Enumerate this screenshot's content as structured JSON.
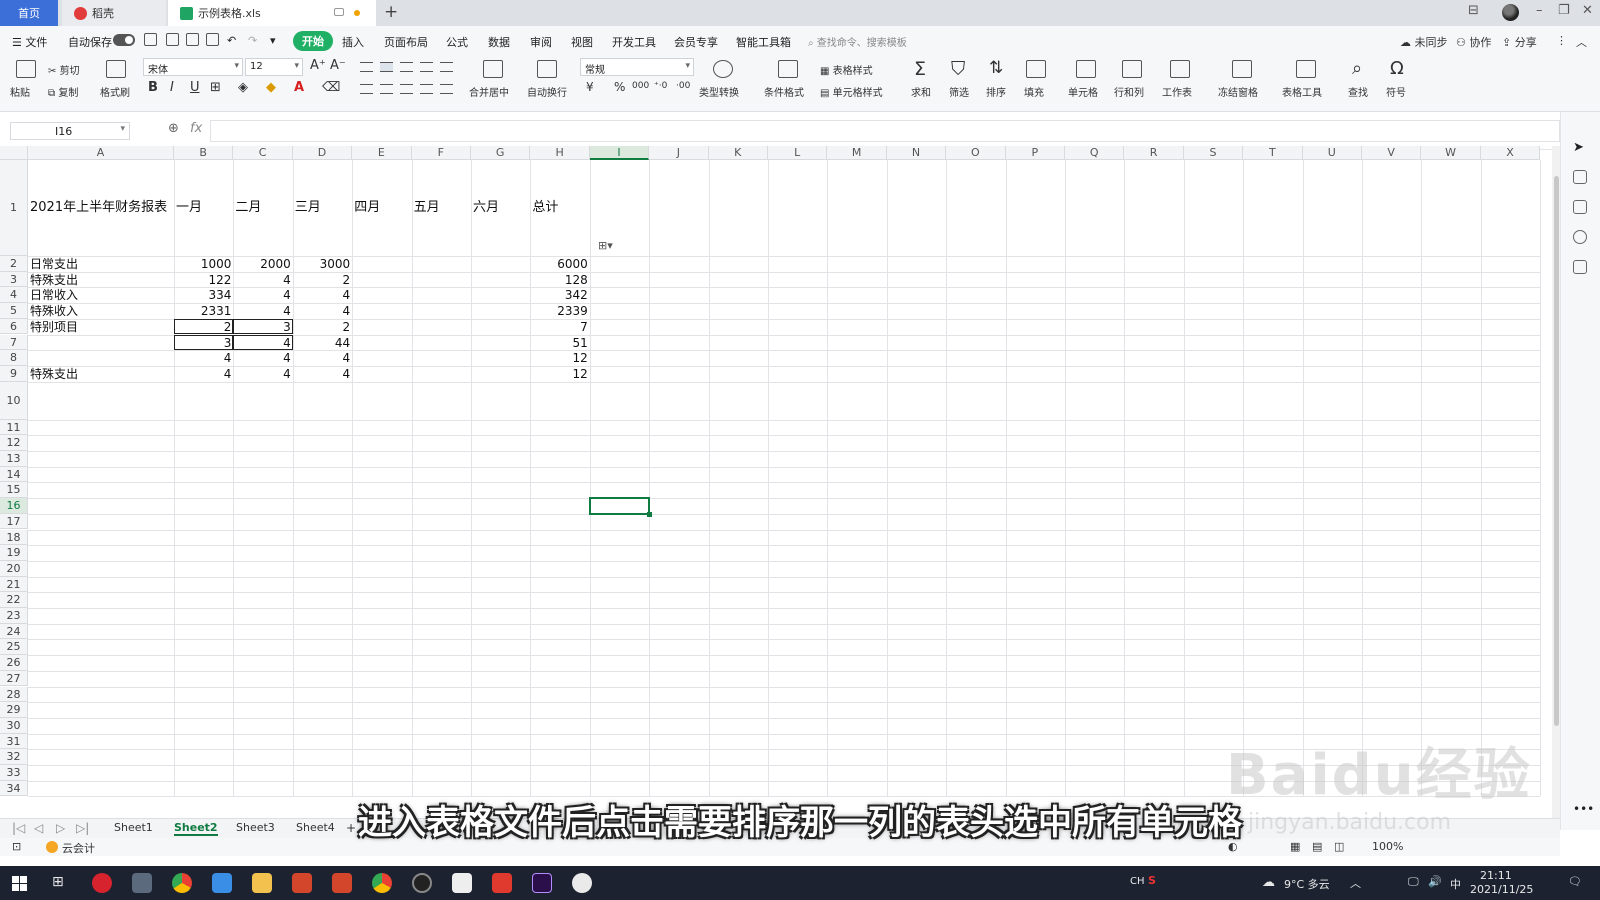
{
  "tabs": [
    {
      "label": "首页",
      "active": true
    },
    {
      "label": "稻壳",
      "active": false
    },
    {
      "label": "示例表格.xls",
      "active": true
    }
  ],
  "menu": {
    "file": "文件",
    "autosave": "自动保存",
    "items": [
      "开始",
      "插入",
      "页面布局",
      "公式",
      "数据",
      "审阅",
      "视图",
      "开发工具",
      "会员专享",
      "智能工具箱"
    ],
    "active_item": "开始",
    "search_placeholder": "查找命令、搜索模板",
    "sync": "未同步",
    "collab": "协作",
    "share": "分享"
  },
  "ribbon": {
    "paste": "粘贴",
    "cut": "剪切",
    "copy": "复制",
    "format_painter": "格式刷",
    "font_name": "宋体",
    "font_size": "12",
    "bold": "B",
    "italic": "I",
    "underline": "U",
    "merge_center": "合并居中",
    "wrap_text": "自动换行",
    "number_format": "常规",
    "type_convert": "类型转换",
    "conditional_format": "条件格式",
    "table_style": "表格样式",
    "cell_style": "单元格样式",
    "sum": "求和",
    "filter": "筛选",
    "sort": "排序",
    "fill": "填充",
    "cell": "单元格",
    "row_col": "行和列",
    "worksheet": "工作表",
    "freeze": "冻结窗格",
    "table_tools": "表格工具",
    "find": "查找",
    "symbol": "符号",
    "currency": "¥",
    "percent": "%",
    "thousands": "000"
  },
  "formula": {
    "cell_ref": "I16",
    "fx": "fx",
    "value": ""
  },
  "columns": [
    "A",
    "B",
    "C",
    "D",
    "E",
    "F",
    "G",
    "H",
    "I",
    "J",
    "K",
    "L",
    "M",
    "N",
    "O",
    "P",
    "Q",
    "R",
    "S",
    "T",
    "U",
    "V",
    "W",
    "X"
  ],
  "selected_column": "I",
  "rows": [
    "1",
    "2",
    "3",
    "4",
    "5",
    "6",
    "7",
    "8",
    "9",
    "10",
    "11",
    "12",
    "13",
    "14",
    "15",
    "16",
    "17",
    "18",
    "19",
    "20",
    "21",
    "22",
    "23",
    "24",
    "25",
    "26",
    "27",
    "28",
    "29",
    "30",
    "31",
    "32",
    "33",
    "34"
  ],
  "selected_row": "16",
  "sheet": {
    "r1": {
      "A": "2021年上半年财务报表",
      "B": "一月",
      "C": "二月",
      "D": "三月",
      "E": "四月",
      "F": "五月",
      "G": "六月",
      "H": "总计"
    },
    "r2": {
      "A": "日常支出",
      "B": "1000",
      "C": "2000",
      "D": "3000",
      "H": "6000"
    },
    "r3": {
      "A": "特殊支出",
      "B": "122",
      "C": "4",
      "D": "2",
      "H": "128"
    },
    "r4": {
      "A": "日常收入",
      "B": "334",
      "C": "4",
      "D": "4",
      "H": "342"
    },
    "r5": {
      "A": "特殊收入",
      "B": "2331",
      "C": "4",
      "D": "4",
      "H": "2339"
    },
    "r6": {
      "A": "特别项目",
      "B": "2",
      "C": "3",
      "D": "2",
      "H": "7"
    },
    "r7": {
      "A": "",
      "B": "3",
      "C": "4",
      "D": "44",
      "H": "51"
    },
    "r8": {
      "A": "",
      "B": "4",
      "C": "4",
      "D": "4",
      "H": "12"
    },
    "r9": {
      "A": "特殊支出",
      "B": "4",
      "C": "4",
      "D": "4",
      "H": "12"
    }
  },
  "sheet_tabs": [
    "Sheet1",
    "Sheet2",
    "Sheet3",
    "Sheet4"
  ],
  "active_sheet": "Sheet2",
  "status": {
    "cloud_accounting": "云会计",
    "zoom": "100%"
  },
  "caption": "进入表格文件后点击需要排序那一列的表头选中所有单元格",
  "watermark": "Baidu经验",
  "watermark_url": "jingyan.baidu.com",
  "taskbar": {
    "ime": "CH",
    "weather": "9°C 多云",
    "ime2": "中",
    "time": "21:11",
    "date": "2021/11/25"
  }
}
